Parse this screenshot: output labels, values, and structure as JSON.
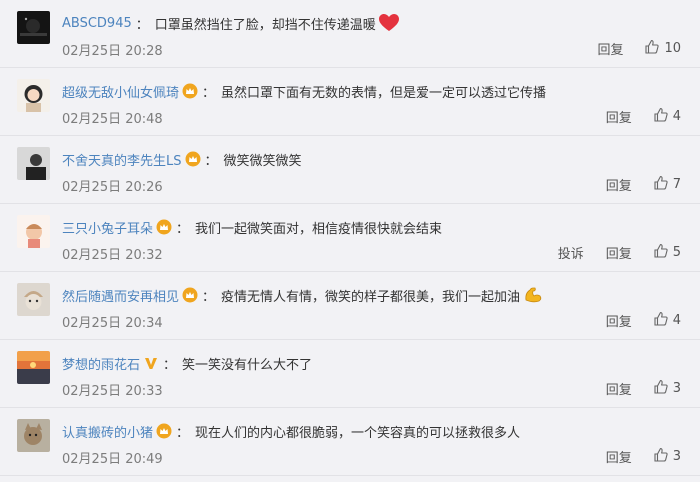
{
  "comments": [
    {
      "user": "ABSCD945",
      "badge": "none",
      "text": "口罩虽然挡住了脸，却挡不住传递温暖",
      "emoji": "red-heart",
      "time": "02月25日 20:28",
      "reply_label": "回复",
      "likes": "10",
      "avatar": "dark-night-photo"
    },
    {
      "user": "超级无敌小仙女佩琦",
      "badge": "crown",
      "text": "虽然口罩下面有无数的表情，但是爱一定可以透过它传播",
      "time": "02月25日 20:48",
      "reply_label": "回复",
      "likes": "4",
      "avatar": "cartoon-girl"
    },
    {
      "user": "不舍天真的李先生LS",
      "badge": "crown",
      "text": "微笑微笑微笑",
      "time": "02月25日 20:26",
      "reply_label": "回复",
      "likes": "7",
      "avatar": "bw-portrait"
    },
    {
      "user": "三只小兔子耳朵",
      "badge": "crown",
      "text": "我们一起微笑面对，相信疫情很快就会结束",
      "time": "02月25日 20:32",
      "report_label": "投诉",
      "reply_label": "回复",
      "likes": "5",
      "avatar": "cartoon-kid"
    },
    {
      "user": "然后随遇而安再相见",
      "badge": "crown",
      "text": "疫情无情人有情，微笑的样子都很美，我们一起加油",
      "emoji": "flexed-biceps",
      "time": "02月25日 20:34",
      "reply_label": "回复",
      "likes": "4",
      "avatar": "cat-hat"
    },
    {
      "user": "梦想的雨花石",
      "badge": "v",
      "text": "笑一笑没有什么大不了",
      "time": "02月25日 20:33",
      "reply_label": "回复",
      "likes": "3",
      "avatar": "sunset"
    },
    {
      "user": "认真搬砖的小猪",
      "badge": "crown",
      "text": "现在人们的内心都很脆弱，一个笑容真的可以拯救很多人",
      "time": "02月25日 20:49",
      "reply_label": "回复",
      "likes": "3",
      "avatar": "cat-photo"
    }
  ],
  "colors": {
    "username": "#4d84be",
    "background": "#f2f2f5",
    "badge_gold": "#f0a51e",
    "heart": "#e4323e"
  }
}
